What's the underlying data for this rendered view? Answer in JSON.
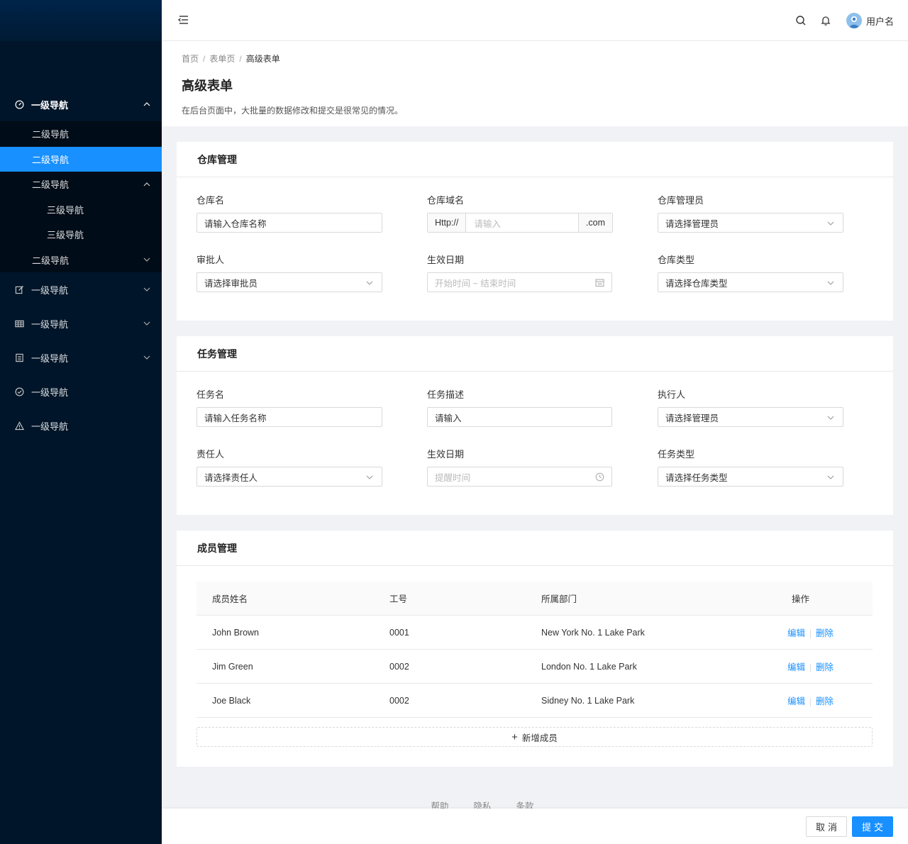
{
  "sidebar": {
    "items": [
      {
        "label": "一级导航",
        "icon": "dashboard-icon"
      },
      {
        "label": "二级导航"
      },
      {
        "label": "二级导航"
      },
      {
        "label": "二级导航"
      },
      {
        "label": "三级导航"
      },
      {
        "label": "三级导航"
      },
      {
        "label": "二级导航"
      },
      {
        "label": "一级导航",
        "icon": "edit-icon"
      },
      {
        "label": "一级导航",
        "icon": "table-icon"
      },
      {
        "label": "一级导航",
        "icon": "list-icon"
      },
      {
        "label": "一级导航",
        "icon": "check-circle-icon"
      },
      {
        "label": "一级导航",
        "icon": "warning-icon"
      }
    ]
  },
  "header": {
    "username": "用户名",
    "icons": [
      "menu-fold-icon",
      "search-icon",
      "bell-icon",
      "avatar"
    ]
  },
  "breadcrumb": [
    "首页",
    "表单页",
    "高级表单"
  ],
  "page": {
    "title": "高级表单",
    "desc": "在后台页面中，大批量的数据修改和提交是很常见的情况。"
  },
  "warehouse": {
    "title": "仓库管理",
    "name_label": "仓库名",
    "name_value": "请输入仓库名称",
    "domain_label": "仓库域名",
    "domain_prefix": "Http://",
    "domain_placeholder": "请输入",
    "domain_suffix": ".com",
    "admin_label": "仓库管理员",
    "admin_value": "请选择管理员",
    "approver_label": "审批人",
    "approver_value": "请选择审批员",
    "date_label": "生效日期",
    "date_placeholder": "开始时间 ~ 结束时间",
    "type_label": "仓库类型",
    "type_value": "请选择仓库类型"
  },
  "task": {
    "title": "任务管理",
    "name_label": "任务名",
    "name_value": "请输入任务名称",
    "desc_label": "任务描述",
    "desc_value": "请输入",
    "executor_label": "执行人",
    "executor_value": "请选择管理员",
    "owner_label": "责任人",
    "owner_value": "请选择责任人",
    "date_label": "生效日期",
    "date_placeholder": "提醒时间",
    "type_label": "任务类型",
    "type_value": "请选择任务类型"
  },
  "members": {
    "title": "成员管理",
    "columns": [
      "成员姓名",
      "工号",
      "所属部门",
      "操作"
    ],
    "rows": [
      {
        "name": "John Brown",
        "id": "0001",
        "dept": "New York No. 1 Lake Park",
        "edit": "编辑",
        "del": "删除"
      },
      {
        "name": "Jim Green",
        "id": "0002",
        "dept": "London No. 1 Lake Park",
        "edit": "编辑",
        "del": "删除"
      },
      {
        "name": "Joe Black",
        "id": "0002",
        "dept": "Sidney No. 1 Lake Park",
        "edit": "编辑",
        "del": "删除"
      }
    ],
    "add_label": "新增成员"
  },
  "footer": {
    "links": [
      "帮助",
      "隐私",
      "条款"
    ]
  },
  "actions": {
    "cancel": "取消",
    "submit": "提交"
  },
  "colors": {
    "sidebar_bg": "#001529",
    "submenu_bg": "#000c17",
    "accent": "#1890ff"
  }
}
